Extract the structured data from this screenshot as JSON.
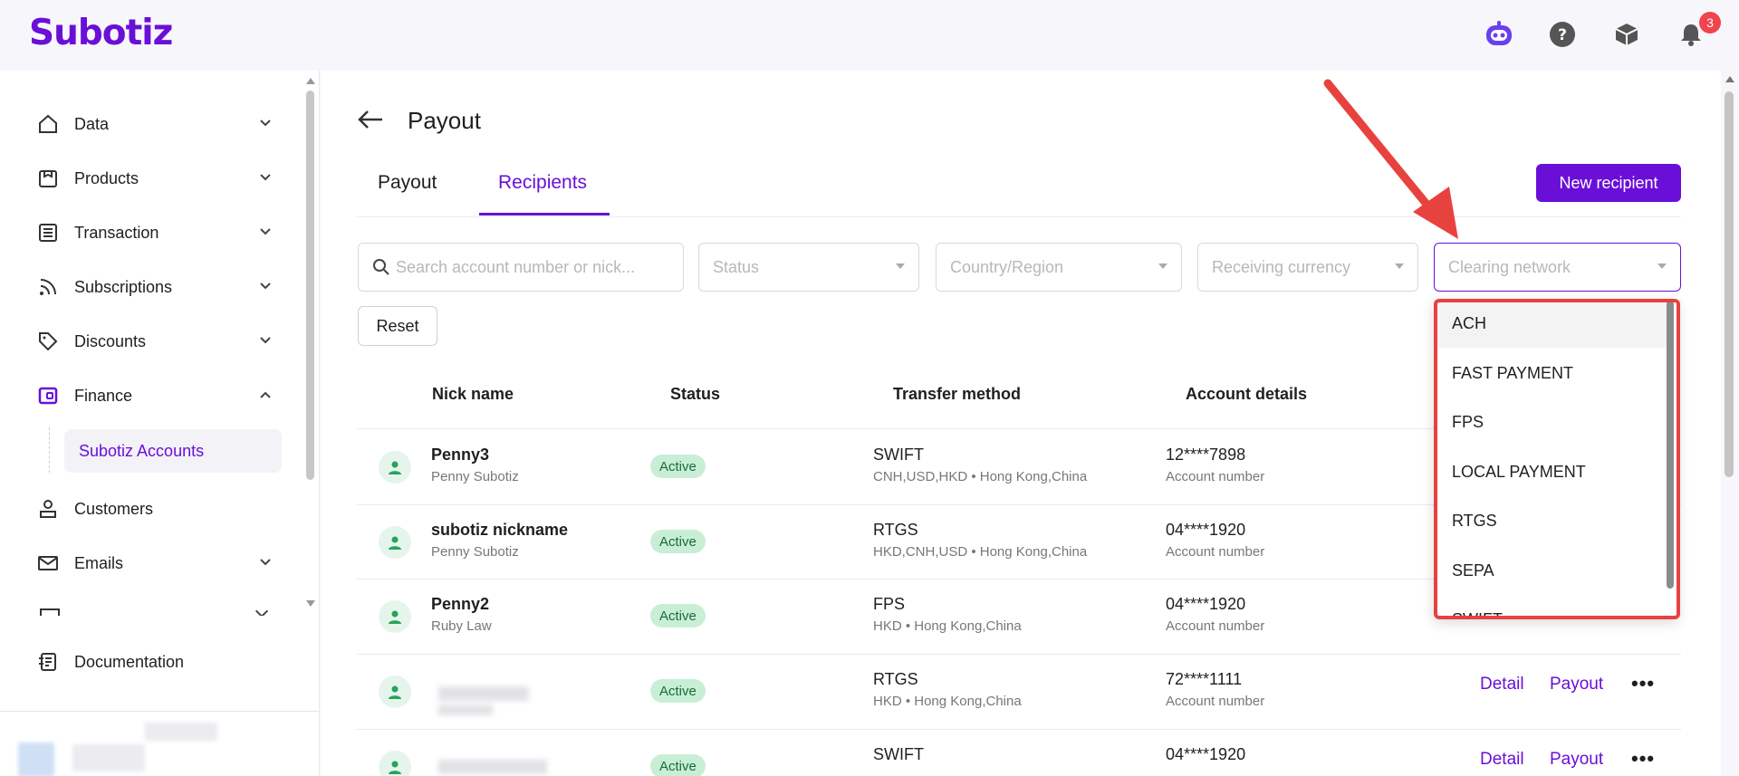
{
  "app": {
    "logo": "Subotiz",
    "notification_count": "3"
  },
  "sidebar": {
    "items": [
      {
        "label": "Data"
      },
      {
        "label": "Products"
      },
      {
        "label": "Transaction"
      },
      {
        "label": "Subscriptions"
      },
      {
        "label": "Discounts"
      },
      {
        "label": "Finance"
      },
      {
        "label": "Customers"
      },
      {
        "label": "Emails"
      },
      {
        "label": "Documentation"
      }
    ],
    "sub_item": "Subotiz Accounts"
  },
  "page": {
    "title": "Payout",
    "tabs": [
      {
        "label": "Payout"
      },
      {
        "label": "Recipients"
      }
    ],
    "new_button": "New recipient",
    "reset_button": "Reset"
  },
  "filters": {
    "search_placeholder": "Search account number or nick...",
    "status": "Status",
    "country": "Country/Region",
    "currency": "Receiving currency",
    "clearing": "Clearing network"
  },
  "table": {
    "headers": [
      "Nick name",
      "Status",
      "Transfer method",
      "Account details"
    ],
    "rows": [
      {
        "nick": "Penny3",
        "sub": "Penny Subotiz",
        "status": "Active",
        "method": "SWIFT",
        "method_sub": "CNH,USD,HKD • Hong Kong,China",
        "account": "12****7898",
        "account_sub": "Account number"
      },
      {
        "nick": "subotiz nickname",
        "sub": "Penny Subotiz",
        "status": "Active",
        "method": "RTGS",
        "method_sub": "HKD,CNH,USD • Hong Kong,China",
        "account": "04****1920",
        "account_sub": "Account number"
      },
      {
        "nick": "Penny2",
        "sub": "Ruby Law",
        "status": "Active",
        "method": "FPS",
        "method_sub": "HKD • Hong Kong,China",
        "account": "04****1920",
        "account_sub": "Account number"
      },
      {
        "nick": "",
        "sub": "",
        "status": "Active",
        "method": "RTGS",
        "method_sub": "HKD • Hong Kong,China",
        "account": "72****1111",
        "account_sub": "Account number",
        "detail": "Detail",
        "payout": "Payout"
      },
      {
        "nick": "",
        "sub": "",
        "status": "Active",
        "method": "SWIFT",
        "method_sub": "",
        "account": "04****1920",
        "account_sub": "",
        "detail": "Detail",
        "payout": "Payout"
      }
    ]
  },
  "dropdown": {
    "options": [
      "ACH",
      "FAST PAYMENT",
      "FPS",
      "LOCAL PAYMENT",
      "RTGS",
      "SEPA",
      "SWIFT"
    ]
  },
  "colors": {
    "accent": "#6a0fd8",
    "annotation": "#e8423f"
  }
}
